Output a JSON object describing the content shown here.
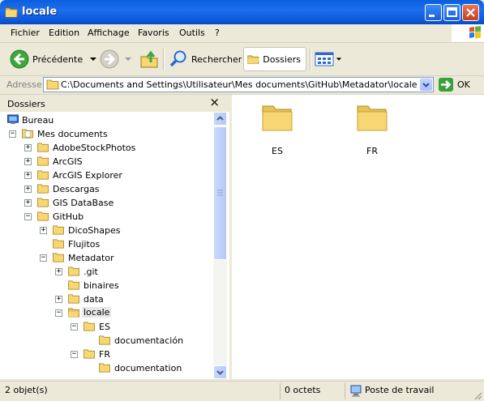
{
  "window": {
    "title": "locale"
  },
  "menu": {
    "items": [
      {
        "label": "Fichier"
      },
      {
        "label": "Edition"
      },
      {
        "label": "Affichage"
      },
      {
        "label": "Favoris"
      },
      {
        "label": "Outils"
      },
      {
        "label": "?"
      }
    ]
  },
  "toolbar": {
    "back_label": "Précédente",
    "search_label": "Rechercher",
    "folders_label": "Dossiers"
  },
  "address": {
    "label": "Adresse",
    "path": "C:\\Documents and Settings\\Utilisateur\\Mes documents\\GitHub\\Metadator\\locale",
    "go_label": "OK"
  },
  "folders_pane": {
    "title": "Dossiers",
    "close": "×",
    "tree": [
      {
        "label": "Bureau"
      },
      {
        "label": "Mes documents"
      },
      {
        "label": "AdobeStockPhotos"
      },
      {
        "label": "ArcGIS"
      },
      {
        "label": "ArcGIS Explorer"
      },
      {
        "label": "Descargas"
      },
      {
        "label": "GIS DataBase"
      },
      {
        "label": "GitHub"
      },
      {
        "label": "DicoShapes"
      },
      {
        "label": "Flujitos"
      },
      {
        "label": "Metadator"
      },
      {
        "label": ".git"
      },
      {
        "label": "binaires"
      },
      {
        "label": "data"
      },
      {
        "label": "locale"
      },
      {
        "label": "ES"
      },
      {
        "label": "documentación"
      },
      {
        "label": "FR"
      },
      {
        "label": "documentation"
      }
    ]
  },
  "content": {
    "items": [
      {
        "label": "ES"
      },
      {
        "label": "FR"
      }
    ]
  },
  "status": {
    "objects": "2 objet(s)",
    "size": "0 octets",
    "location": "Poste de travail"
  },
  "colors": {
    "title_bar": "#0a5fdb",
    "folder_yellow": "#f7d774"
  }
}
